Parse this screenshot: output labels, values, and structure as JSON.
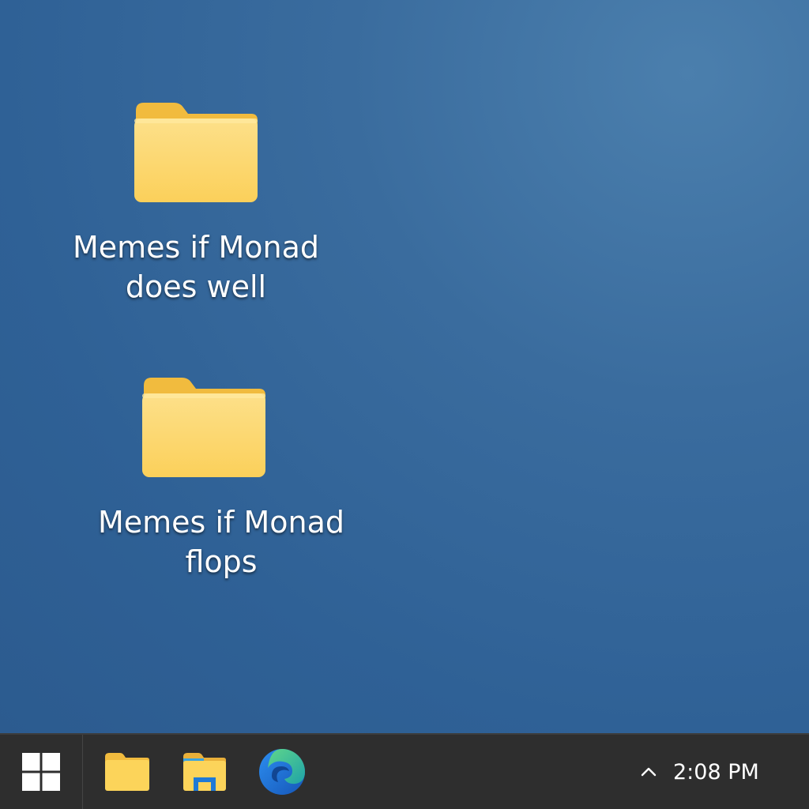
{
  "desktop": {
    "background_color": "#31639a",
    "icons": [
      {
        "label": "Memes if Monad does well",
        "icon": "folder-icon"
      },
      {
        "label": "Memes if Monad flops",
        "icon": "folder-icon"
      }
    ]
  },
  "taskbar": {
    "background_color": "#2e2e2e",
    "pinned": [
      {
        "icon": "windows-start-icon"
      },
      {
        "icon": "folder-icon"
      },
      {
        "icon": "file-explorer-icon"
      },
      {
        "icon": "edge-browser-icon"
      }
    ],
    "tray": {
      "chevron_icon": "chevron-up-icon",
      "clock": "2:08 PM"
    }
  },
  "colors": {
    "folder_front": "#fcd76a",
    "folder_back": "#f1bb3e",
    "accent_edge_blue": "#1f7ad6",
    "accent_edge_green": "#3ec07a"
  }
}
